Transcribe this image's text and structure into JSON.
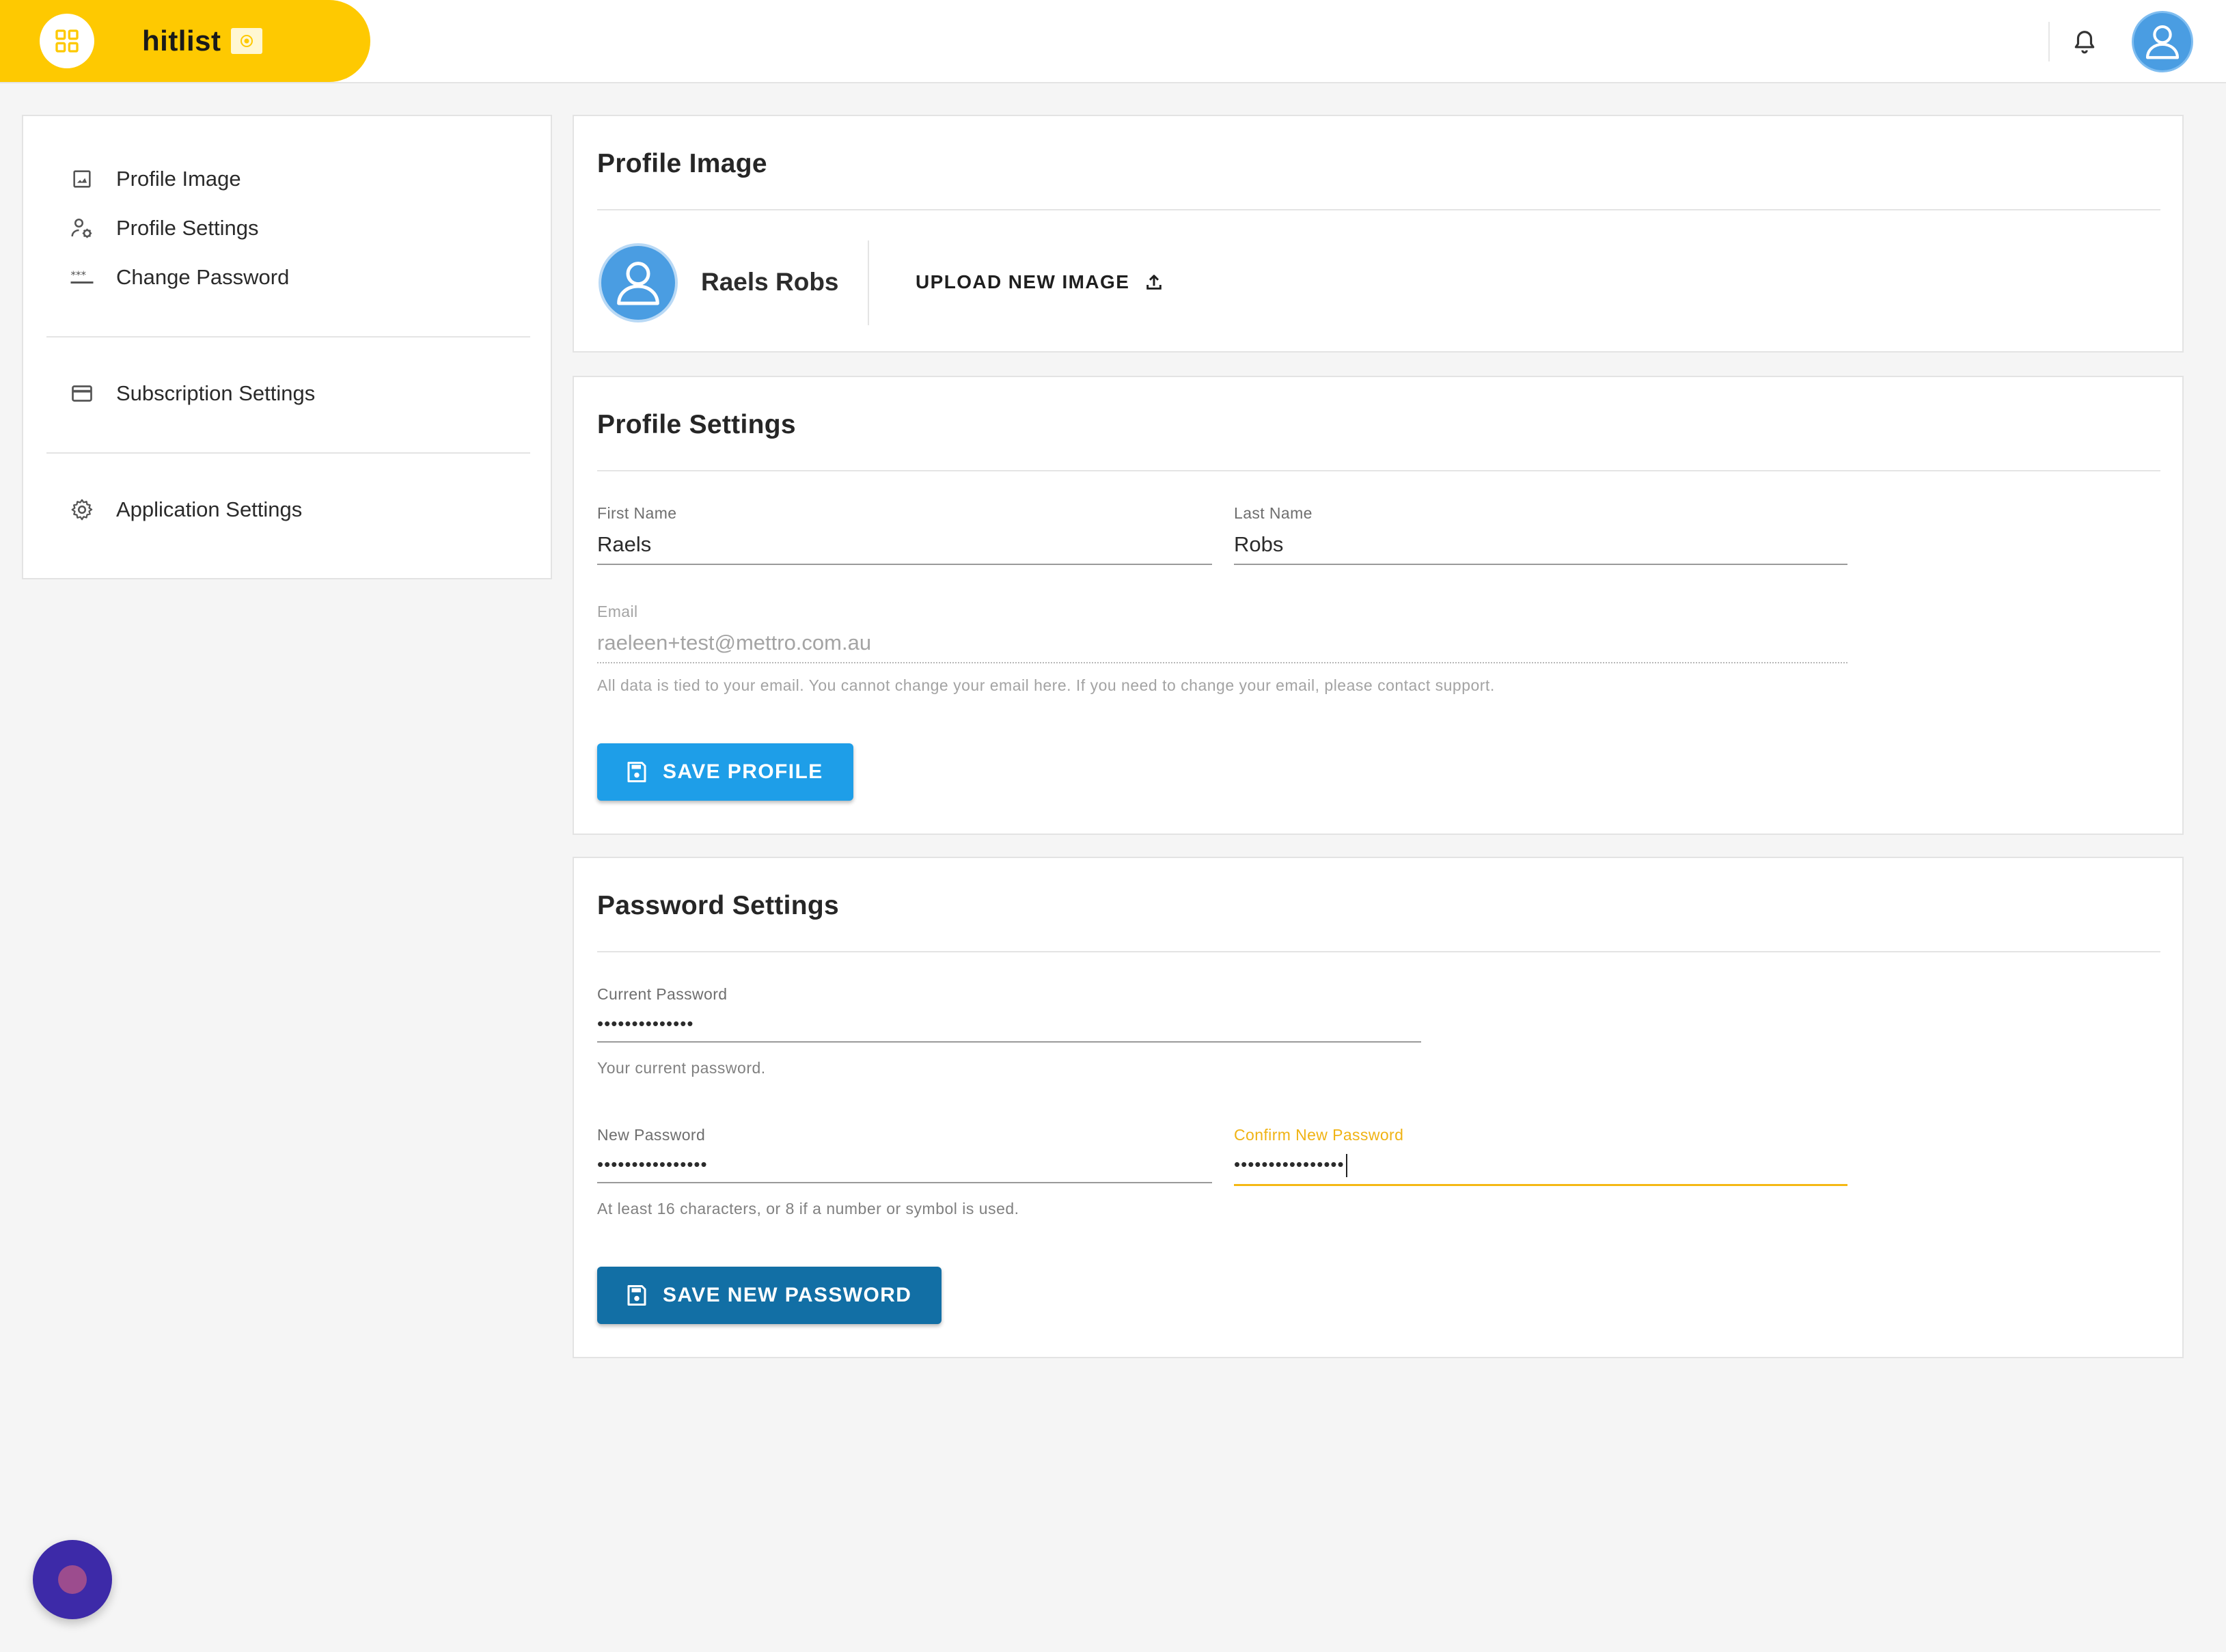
{
  "app": {
    "name": "hitlist",
    "brand_color": "#fec901"
  },
  "header": {
    "apps_icon": "grid-icon",
    "badge_icon": "record-icon",
    "notifications_icon": "bell-icon",
    "avatar_icon": "user-avatar-icon"
  },
  "sidebar": {
    "items": [
      {
        "label": "Profile Image",
        "icon": "image-icon"
      },
      {
        "label": "Profile Settings",
        "icon": "user-settings-icon"
      },
      {
        "label": "Change Password",
        "icon": "password-icon"
      },
      {
        "label": "Subscription Settings",
        "icon": "credit-card-icon"
      },
      {
        "label": "Application Settings",
        "icon": "gear-icon"
      }
    ]
  },
  "profile_image": {
    "title": "Profile Image",
    "user_name": "Raels Robs",
    "upload_label": "UPLOAD NEW IMAGE",
    "upload_icon": "upload-icon"
  },
  "profile_settings": {
    "title": "Profile Settings",
    "first_name": {
      "label": "First Name",
      "value": "Raels"
    },
    "last_name": {
      "label": "Last Name",
      "value": "Robs"
    },
    "email": {
      "label": "Email",
      "value": "raeleen+test@mettro.com.au",
      "hint": "All data is tied to your email. You cannot change your email here. If you need to change your email, please contact support."
    },
    "save_label": "SAVE PROFILE",
    "save_color": "#1e9ee8"
  },
  "password_settings": {
    "title": "Password Settings",
    "current": {
      "label": "Current Password",
      "value": "••••••••••••••",
      "hint": "Your current password."
    },
    "new": {
      "label": "New Password",
      "value": "••••••••••••••••",
      "hint": "At least 16 characters, or 8 if a number or symbol is used."
    },
    "confirm": {
      "label": "Confirm New Password",
      "value": "••••••••••••••••"
    },
    "save_label": "SAVE NEW PASSWORD",
    "save_color": "#126fa5",
    "focus_color": "#f5b814"
  },
  "chat_widget": {
    "icon": "chat-bubble-icon"
  }
}
